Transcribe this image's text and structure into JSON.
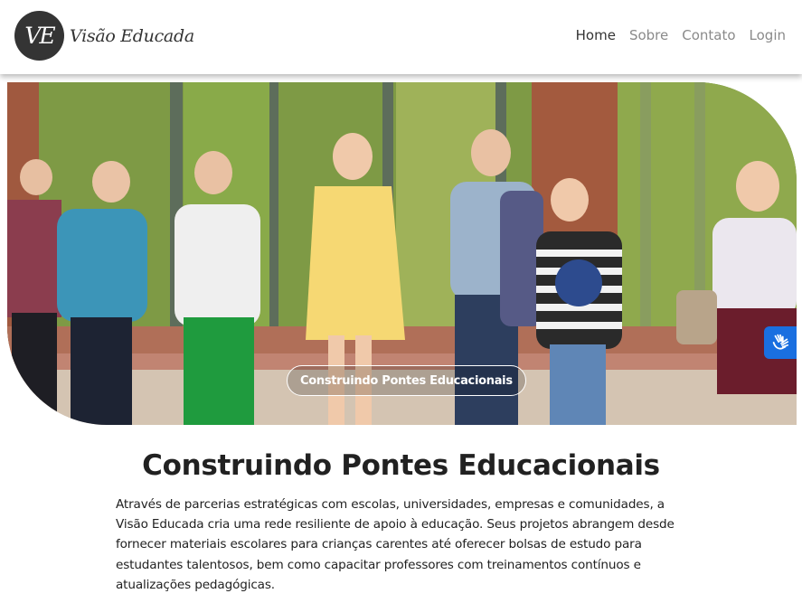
{
  "brand": {
    "logo_text": "VE",
    "name": "Visão Educada"
  },
  "nav": {
    "items": [
      {
        "label": "Home",
        "active": true
      },
      {
        "label": "Sobre",
        "active": false
      },
      {
        "label": "Contato",
        "active": false
      },
      {
        "label": "Login",
        "active": false
      }
    ]
  },
  "hero": {
    "image_subject": "children-walking-with-backpacks",
    "caption": "Construindo Pontes Educacionais"
  },
  "accessibility": {
    "icon": "sign-language-hands-icon",
    "color": "#1a6fe0"
  },
  "main": {
    "title": "Construindo Pontes Educacionais",
    "paragraph": "Através de parcerias estratégicas com escolas, universidades, empresas e comunidades, a Visão Educada cria uma rede resiliente de apoio à educação. Seus projetos abrangem desde fornecer materiais escolares para crianças carentes até oferecer bolsas de estudo para estudantes talentosos, bem como capacitar professores com treinamentos contínuos e atualizações pedagógicas."
  }
}
